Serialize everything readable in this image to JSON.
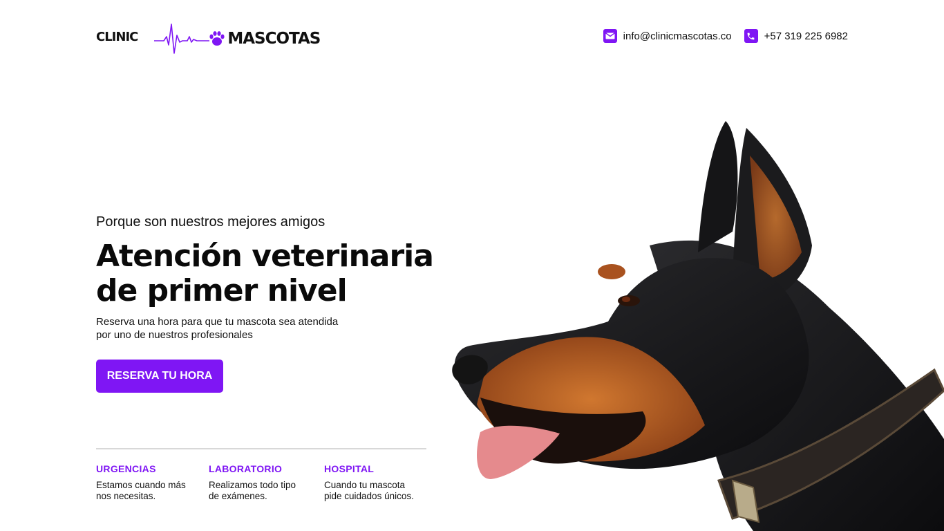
{
  "header": {
    "logo": {
      "clinic": "CLINIC",
      "mascotas": "MASCOTAS",
      "pulse_icon": "heartbeat-line-icon",
      "paw_icon": "paw-icon"
    },
    "email": {
      "icon": "envelope-icon",
      "text": "info@clinicmascotas.co"
    },
    "phone": {
      "icon": "phone-icon",
      "text": "+57 319 225 6982"
    }
  },
  "hero": {
    "tagline": "Porque son nuestros mejores amigos",
    "headline_line1": "Atención veterinaria",
    "headline_line2": "de primer nivel",
    "subtitle_line1": "Reserva una hora para que tu mascota sea atendida",
    "subtitle_line2": "por uno de nuestros profesionales",
    "cta_label": "RESERVA TU HORA"
  },
  "features": [
    {
      "title": "URGENCIAS",
      "desc_line1": "Estamos cuando más",
      "desc_line2": "nos necesitas."
    },
    {
      "title": "LABORATORIO",
      "desc_line1": "Realizamos todo tipo",
      "desc_line2": "de exámenes."
    },
    {
      "title": "HOSPITAL",
      "desc_line1": "Cuando tu mascota",
      "desc_line2": "pide cuidados únicos."
    }
  ],
  "image": {
    "subject": "doberman-dog-profile"
  },
  "colors": {
    "accent": "#7f16f4",
    "text": "#111111",
    "background": "#ffffff"
  }
}
